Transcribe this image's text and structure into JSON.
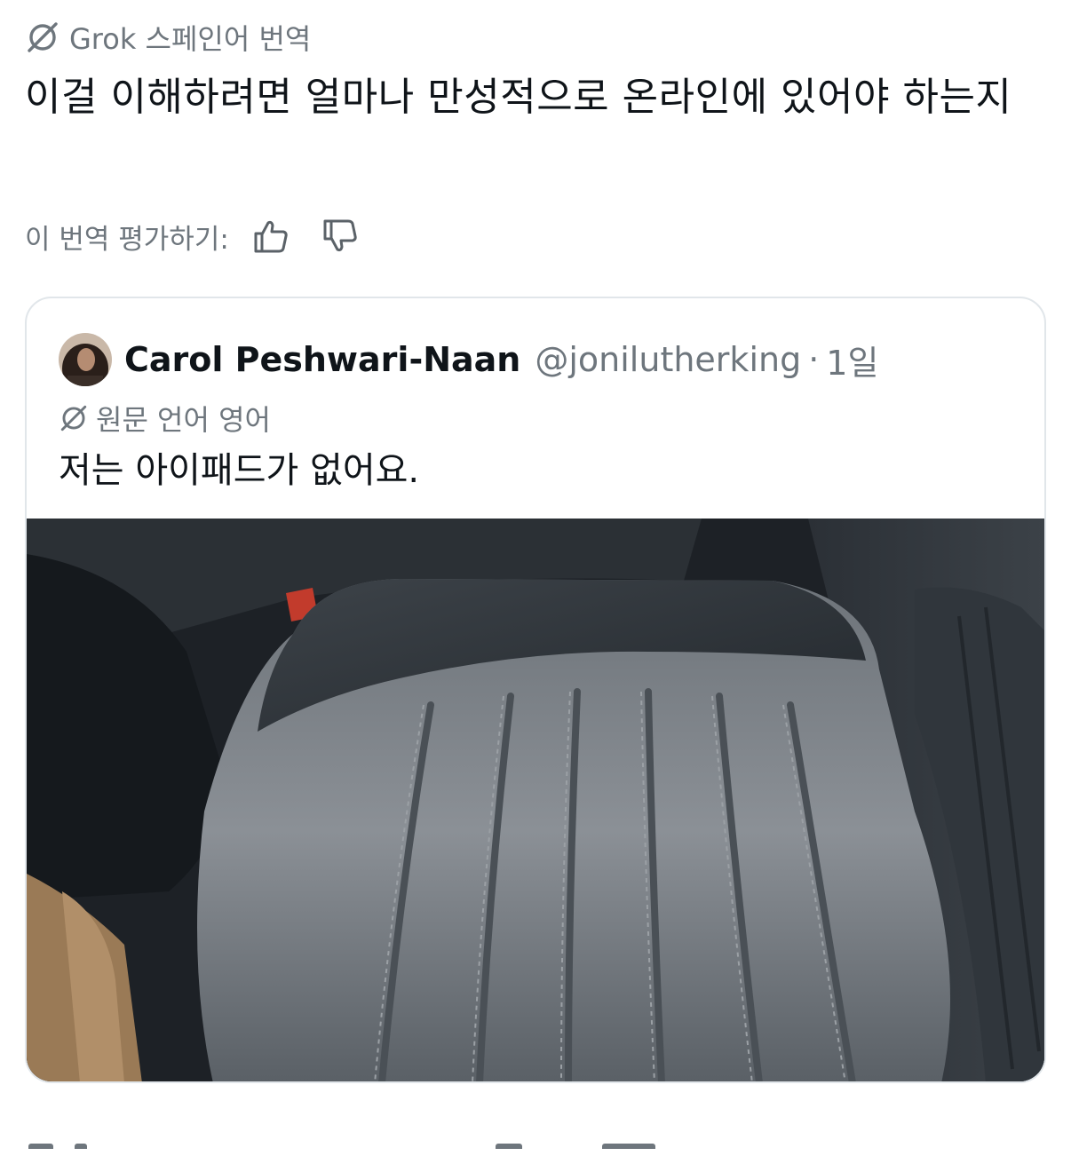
{
  "translation": {
    "header_label": "Grok 스페인어 번역",
    "translated_text": "이걸 이해하려면 얼마나 만성적으로 온라인에 있어야 하는지",
    "rate_label": "이 번역 평가하기:",
    "icons": {
      "translate": "grok-translate-icon",
      "up": "thumbs-up-icon",
      "down": "thumbs-down-icon"
    }
  },
  "quote": {
    "author_name": "Carol Peshwari-Naan",
    "author_handle": "@jonilutherking",
    "separator": "·",
    "time": "1일",
    "original_language_label": "원문 언어 영어",
    "text": "저는 아이패드가 없어요.",
    "media": {
      "description_icon": "car-seat-photo",
      "dominant_color": "#2c3136"
    }
  },
  "colors": {
    "text_primary": "#0f1419",
    "text_secondary": "#6e767d",
    "border": "#e1e6ea",
    "background": "#ffffff"
  }
}
